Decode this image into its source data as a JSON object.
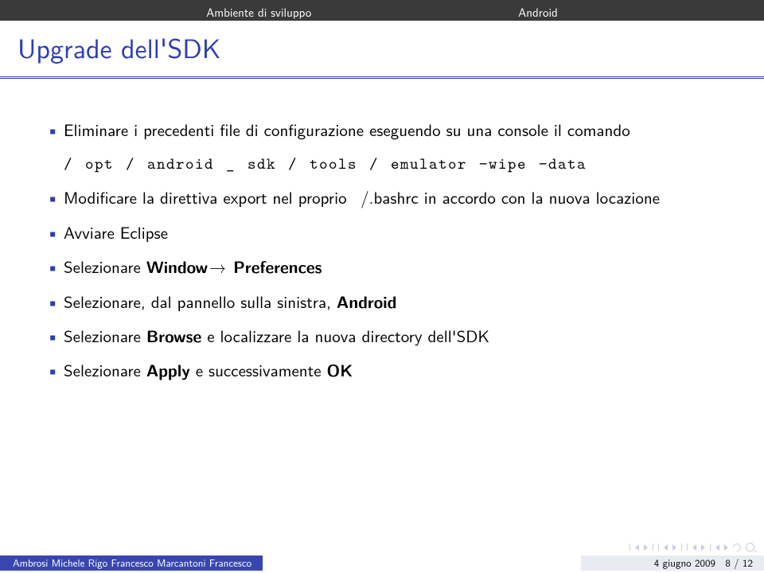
{
  "colors": {
    "structure": "#2f3db3",
    "topbar_bg": "#3a3a3a",
    "footer_author_bg": "#3946b0",
    "footer_mid_bg": "#2b3686",
    "footer_right_bg": "#e9ebf3"
  },
  "topbar": {
    "left": "Ambiente di sviluppo",
    "right": "Android"
  },
  "title": "Upgrade dell'SDK",
  "bullets": [
    {
      "text": "Eliminare i precedenti file di configurazione eseguendo su una console il comando"
    },
    {
      "code": "/opt/android_sdk/tools/emulator −wipe−data"
    },
    {
      "text": "Modificare la direttiva export nel proprio  /.bashrc in accordo con la nuova locazione"
    },
    {
      "text": "Avviare Eclipse"
    },
    {
      "parts": [
        "Selezionare ",
        {
          "b": "Window"
        },
        "→ ",
        {
          "b": "Preferences"
        }
      ]
    },
    {
      "parts": [
        "Selezionare, dal pannello sulla sinistra, ",
        {
          "b": "Android"
        }
      ]
    },
    {
      "parts": [
        "Selezionare ",
        {
          "b": "Browse"
        },
        " e localizzare la nuova directory dell'SDK"
      ]
    },
    {
      "parts": [
        "Selezionare ",
        {
          "b": "Apply"
        },
        " e successivamente ",
        {
          "b": "OK"
        }
      ]
    }
  ],
  "footer": {
    "authors": "Ambrosi Michele Rigo Francesco Marcantoni Francesco",
    "date": "4 giugno 2009",
    "page_current": 8,
    "page_total": 12,
    "page_sep": " / "
  }
}
